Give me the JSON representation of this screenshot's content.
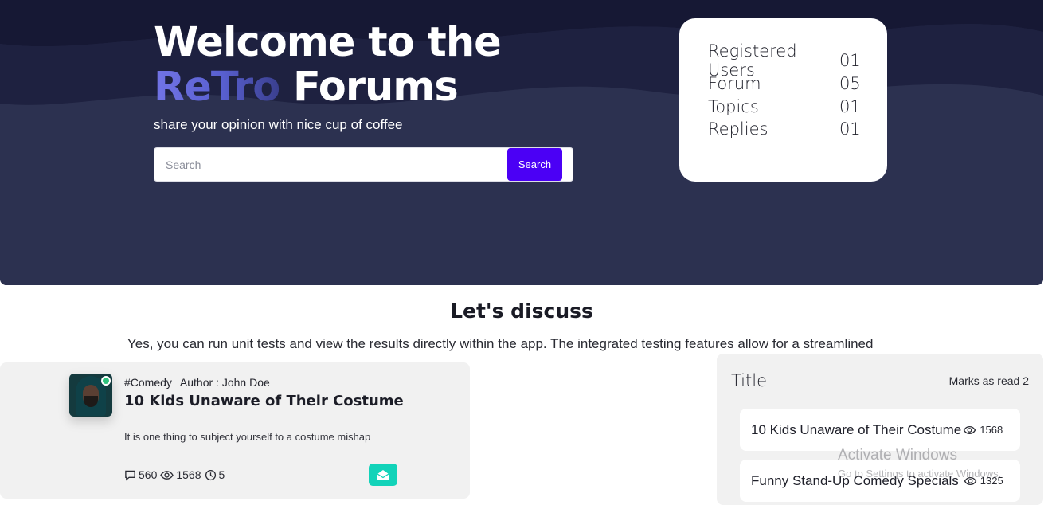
{
  "hero": {
    "title_line1": "Welcome to the",
    "brand": "ReTro",
    "title_rest": " Forums",
    "subtitle": "share your opinion with nice cup of coffee",
    "search": {
      "placeholder": "Search",
      "button_label": "Search"
    }
  },
  "stats": [
    {
      "label": "Registered Users",
      "value": "01"
    },
    {
      "label": "Forum",
      "value": "05"
    },
    {
      "label": "Topics",
      "value": "01"
    },
    {
      "label": "Replies",
      "value": "01"
    }
  ],
  "section": {
    "title": "Let's discuss",
    "description": "Yes, you can run unit tests and view the results directly within the app. The integrated testing features allow for a streamlined"
  },
  "post": {
    "tag": "#Comedy",
    "author": "Author : John Doe",
    "title": "10 Kids Unaware of Their Costume",
    "excerpt": "It is one thing to subject yourself to a costume mishap",
    "comments": "560",
    "views": "1568",
    "time": "5",
    "online": true,
    "accent_color": "#12d3b9"
  },
  "side_panel": {
    "title": "Title",
    "mark_read": "Marks as read 2",
    "topics": [
      {
        "title": "10 Kids Unaware of Their Costume",
        "views": "1568"
      },
      {
        "title": "Funny Stand-Up Comedy Specials",
        "views": "1325"
      }
    ]
  },
  "watermark": {
    "title": "Activate Windows",
    "subtitle": "Go to Settings to activate Windows."
  },
  "colors": {
    "hero_bg": "#262a45",
    "search_button": "#4b00f5",
    "brand_gradient_start": "#7274e6",
    "online": "#2fc27d"
  },
  "icons": {
    "comments": "chat-bubble-icon",
    "views": "eye-icon",
    "time": "clock-icon",
    "mail": "open-envelope-icon"
  }
}
